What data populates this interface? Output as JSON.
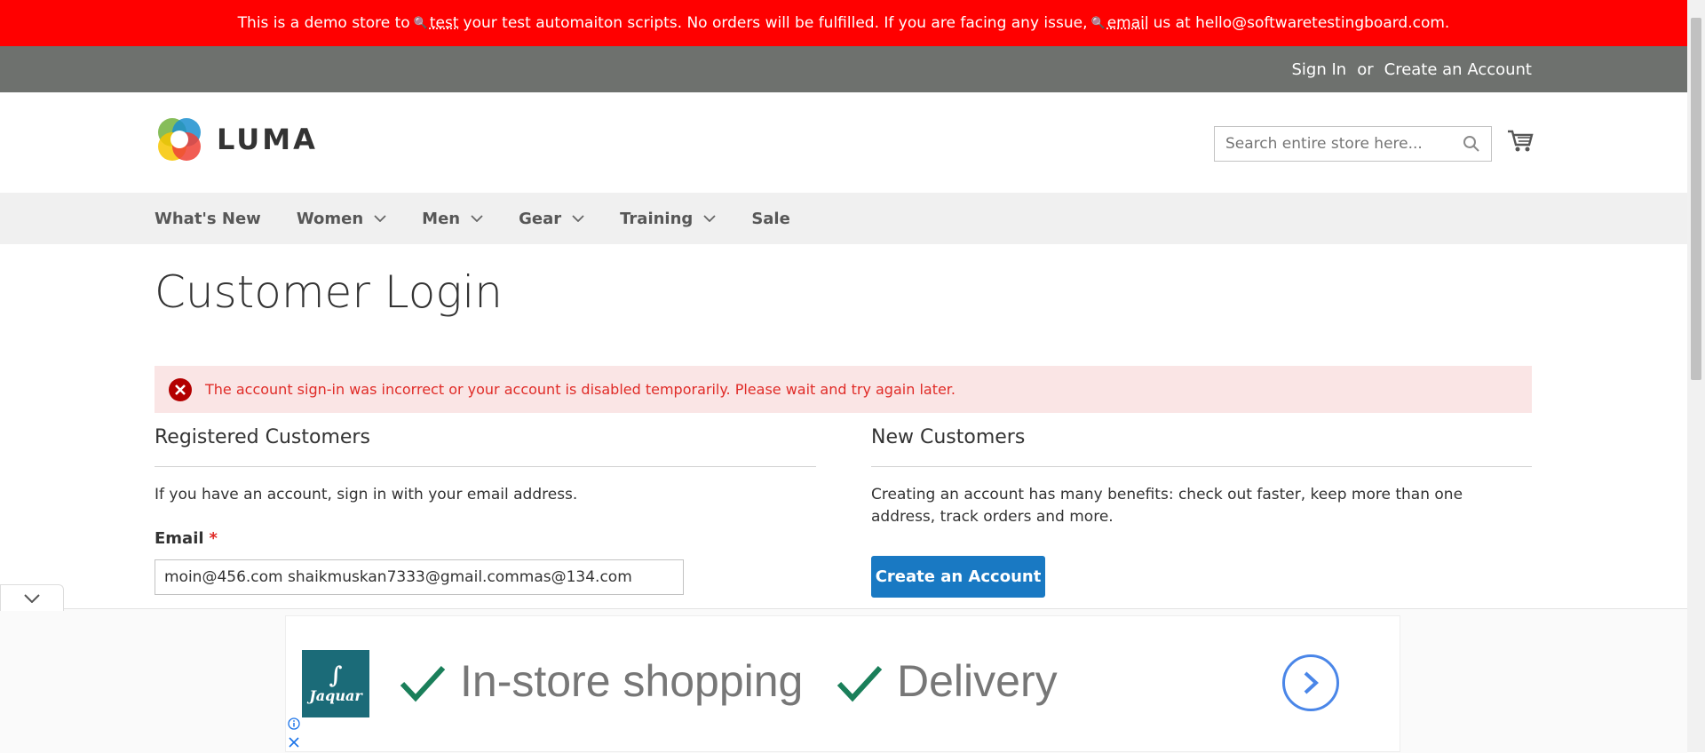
{
  "notice": {
    "part1": "This is a demo store to",
    "link1": "test",
    "part2": "your test automaiton scripts. No orders will be fulfilled. If you are facing any issue,",
    "link2": "email",
    "part3": "us at hello@softwaretestingboard.com."
  },
  "topbar": {
    "sign_in": "Sign In",
    "or": "or",
    "create_account": "Create an Account"
  },
  "header": {
    "logo_text": "LUMA",
    "search_placeholder": "Search entire store here..."
  },
  "nav": {
    "items": [
      {
        "label": "What's New"
      },
      {
        "label": "Women"
      },
      {
        "label": "Men"
      },
      {
        "label": "Gear"
      },
      {
        "label": "Training"
      },
      {
        "label": "Sale"
      }
    ]
  },
  "page": {
    "title": "Customer Login",
    "error": "The account sign-in was incorrect or your account is disabled temporarily. Please wait and try again later.",
    "registered": {
      "title": "Registered Customers",
      "intro": "If you have an account, sign in with your email address.",
      "email_label": "Email",
      "required_mark": "*",
      "email_value": "moin@456.com shaikmuskan7333@gmail.commas@134.com"
    },
    "new_customers": {
      "title": "New Customers",
      "intro": "Creating an account has many benefits: check out faster, keep more than one address, track orders and more.",
      "button": "Create an Account"
    }
  },
  "ad": {
    "brand": "Jaquar",
    "item1": "In-store shopping",
    "item2": "Delivery",
    "check_color": "#1a7f5a",
    "accent": "#4a86e8"
  },
  "colors": {
    "notice_bg": "#ff0000",
    "topbar_bg": "#6e716e",
    "primary_button": "#1979c3",
    "error_text": "#e02b27",
    "error_bg": "#fae5e5"
  }
}
